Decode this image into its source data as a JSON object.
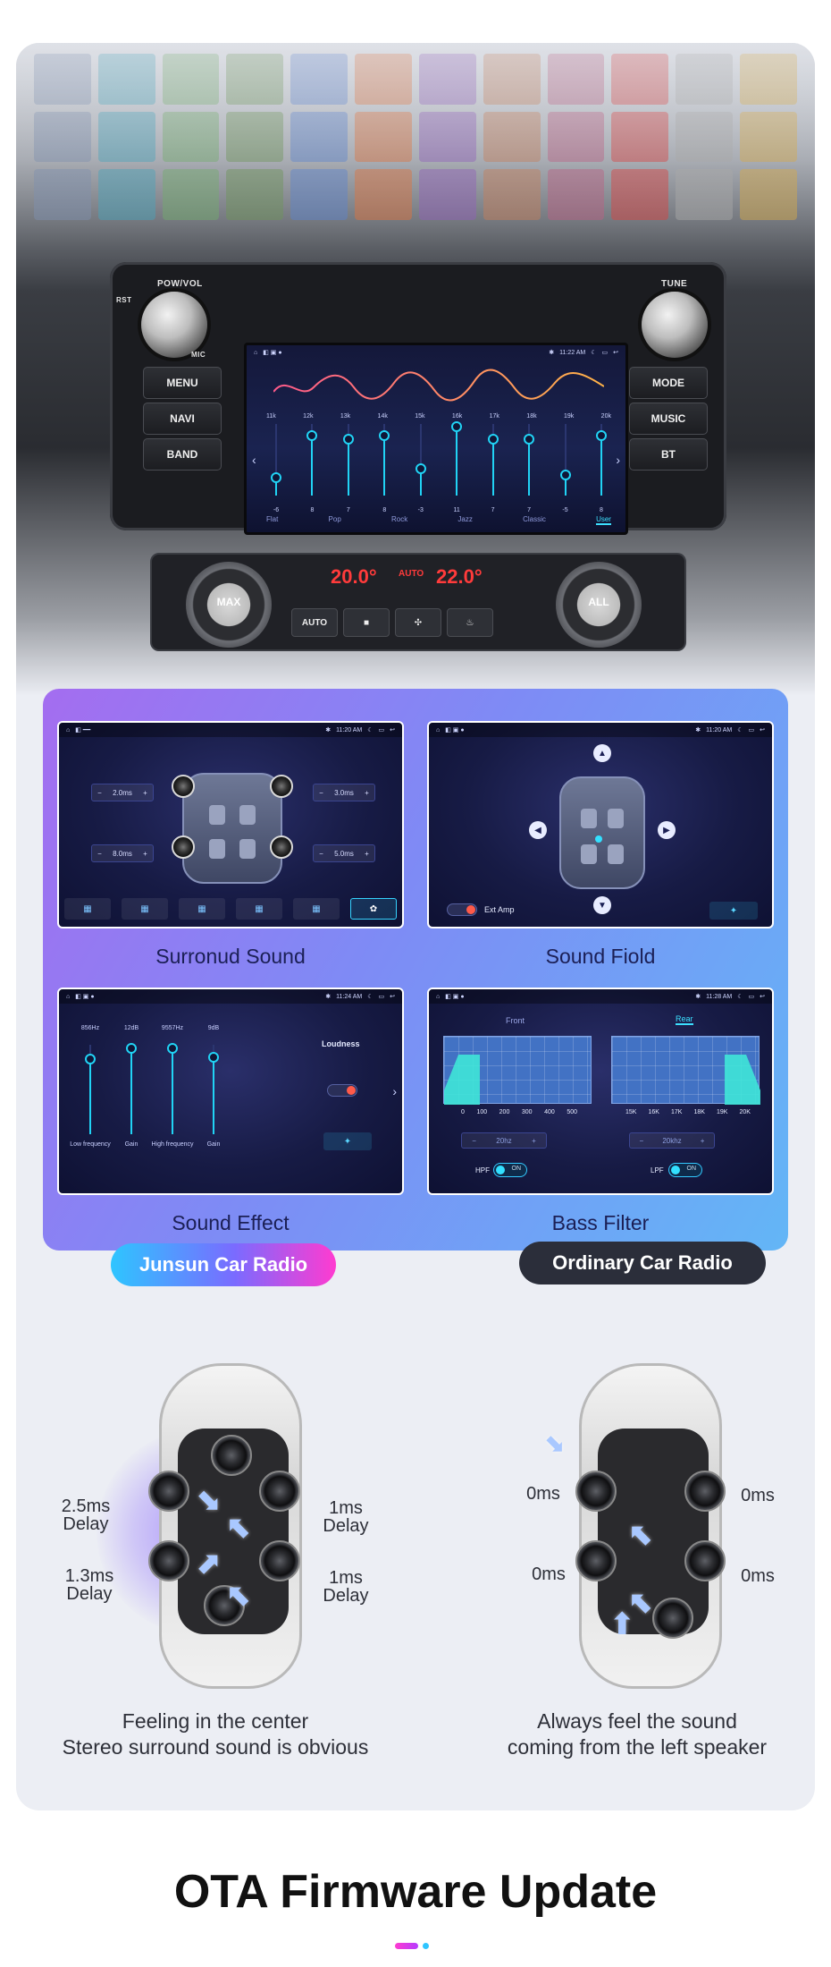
{
  "hero": {
    "knob_left_label": "POW/VOL",
    "knob_left_rst": "RST",
    "knob_left_mic": "MIC",
    "knob_right_label": "TUNE",
    "left_buttons": [
      "MENU",
      "NAVI",
      "BAND"
    ],
    "right_buttons": [
      "MODE",
      "MUSIC",
      "BT"
    ],
    "screen": {
      "time": "11:22 AM",
      "frequencies": [
        "11k",
        "12k",
        "13k",
        "14k",
        "15k",
        "16k",
        "17k",
        "18k",
        "19k",
        "20k"
      ],
      "values": [
        "-6",
        "8",
        "7",
        "8",
        "-3",
        "11",
        "7",
        "7",
        "-5",
        "8"
      ],
      "presets": [
        "Flat",
        "Pop",
        "Rock",
        "Jazz",
        "Classic",
        "User"
      ],
      "active_preset": "User"
    },
    "climate": {
      "left_temp": "20.0°",
      "right_temp": "22.0°",
      "center_label": "AUTO",
      "left_dial": "MAX",
      "right_dial": "ALL",
      "auto_button": "AUTO"
    }
  },
  "features": {
    "tiles": [
      {
        "caption": "Surronud Sound",
        "time": "11:20 AM",
        "chips": [
          "2.0ms",
          "3.0ms",
          "8.0ms",
          "5.0ms"
        ]
      },
      {
        "caption": "Sound Fiold",
        "time": "11:20 AM",
        "toggle_label": "Ext Amp",
        "toggle_state": "OFF"
      },
      {
        "caption": "Sound Effect",
        "time": "11:24 AM",
        "top_labels": [
          "856Hz",
          "12dB",
          "9557Hz",
          "9dB"
        ],
        "bottom_labels": [
          "Low frequency",
          "Gain",
          "High frequency",
          "Gain"
        ],
        "loudness_label": "Loudness",
        "loudness_state": "OFF"
      },
      {
        "caption": "Bass Filter",
        "time": "11:28 AM",
        "tab_front": "Front",
        "tab_rear": "Rear",
        "left_ticks": [
          "0",
          "100",
          "200",
          "300",
          "400",
          "500"
        ],
        "right_ticks": [
          "15K",
          "16K",
          "17K",
          "18K",
          "19K",
          "20K"
        ],
        "hpf_value": "20hz",
        "lpf_value": "20khz",
        "hpf_label": "HPF",
        "lpf_label": "LPF",
        "switch_on": "ON"
      }
    ]
  },
  "comparison": {
    "junsun_label": "Junsun Car Radio",
    "ordinary_label": "Ordinary Car Radio",
    "junsun_delays": {
      "front_left": [
        "2.5ms",
        "Delay"
      ],
      "front_right": [
        "1ms",
        "Delay"
      ],
      "rear_left": [
        "1.3ms",
        "Delay"
      ],
      "rear_right": [
        "1ms",
        "Delay"
      ]
    },
    "ordinary_delays": [
      "0ms",
      "0ms",
      "0ms",
      "0ms"
    ],
    "junsun_caption": [
      "Feeling in the center",
      "Stereo surround sound is obvious"
    ],
    "ordinary_caption": [
      "Always feel the sound",
      "coming from the left speaker"
    ]
  },
  "footer": {
    "title": "OTA Firmware Update"
  },
  "colors": {
    "panel_start": "#a46df0",
    "panel_end": "#63b6f6",
    "accent_cyan": "#21d3f5",
    "temp_red": "#ff3b3b",
    "pill_dark": "#2b2e3a"
  }
}
